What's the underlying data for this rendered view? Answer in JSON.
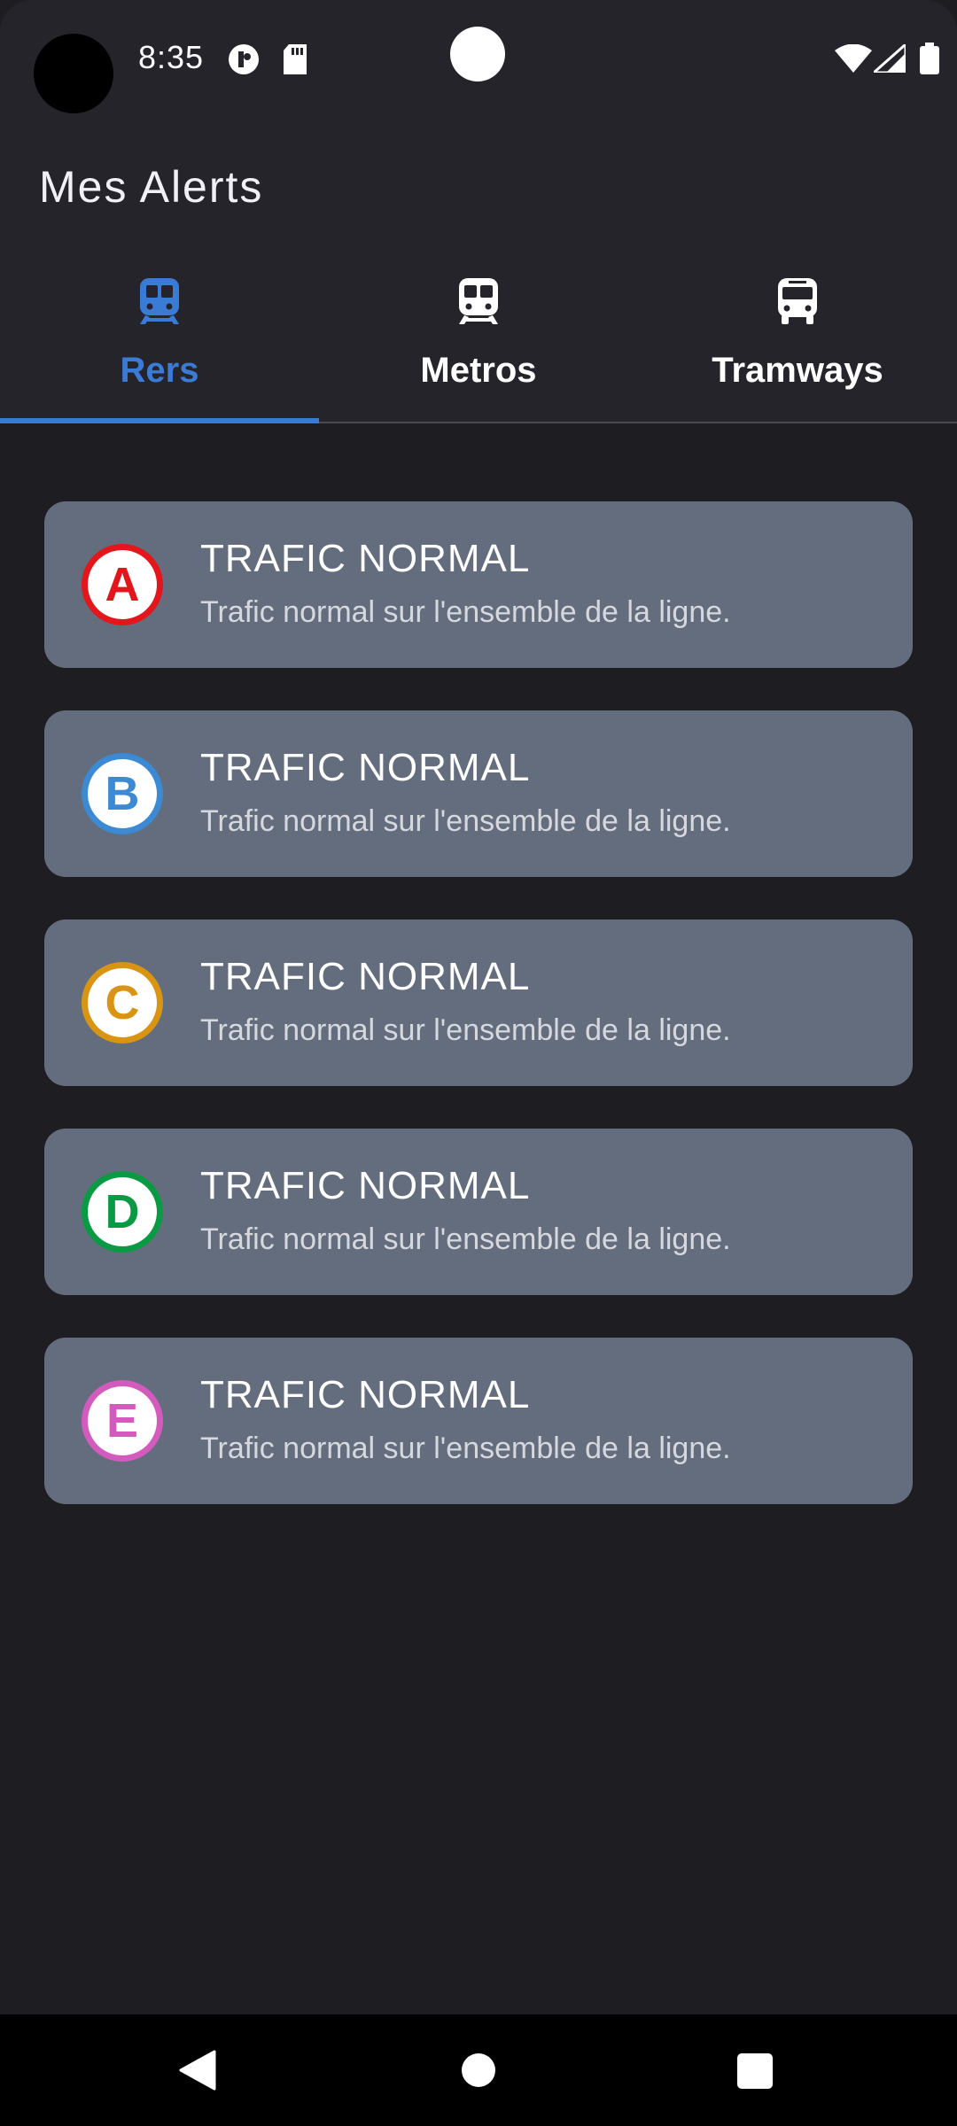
{
  "status_bar": {
    "time": "8:35"
  },
  "app_bar": {
    "title": "Mes Alerts"
  },
  "tabs": [
    {
      "label": "Rers",
      "icon": "train-icon",
      "active": true
    },
    {
      "label": "Metros",
      "icon": "metro-icon",
      "active": false
    },
    {
      "label": "Tramways",
      "icon": "tram-icon",
      "active": false
    }
  ],
  "colors": {
    "accent": "#3a7bd5",
    "card_bg": "#636d7d",
    "background": "#1e1d22",
    "toolbar_bg": "#26242b"
  },
  "alerts": [
    {
      "line": "A",
      "color": "#e3161b",
      "title": "TRAFIC NORMAL",
      "message": "Trafic normal sur l'ensemble de la ligne."
    },
    {
      "line": "B",
      "color": "#3c8ad4",
      "title": "TRAFIC NORMAL",
      "message": "Trafic normal sur l'ensemble de la ligne."
    },
    {
      "line": "C",
      "color": "#d99413",
      "title": "TRAFIC NORMAL",
      "message": "Trafic normal sur l'ensemble de la ligne."
    },
    {
      "line": "D",
      "color": "#0b9a44",
      "title": "TRAFIC NORMAL",
      "message": "Trafic normal sur l'ensemble de la ligne."
    },
    {
      "line": "E",
      "color": "#d35bbd",
      "title": "TRAFIC NORMAL",
      "message": "Trafic normal sur l'ensemble de la ligne."
    }
  ]
}
